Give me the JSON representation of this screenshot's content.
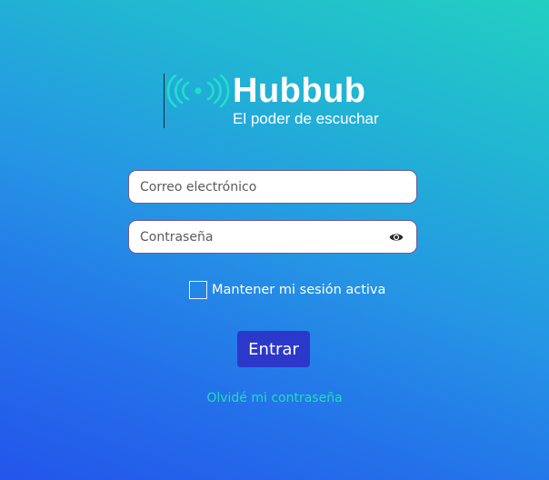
{
  "brand": {
    "name": "Hubbub",
    "tagline": "El poder de escuchar",
    "logo_icon": "broadcast-signal-icon",
    "accent_color": "#1ee0c8"
  },
  "login_form": {
    "email_placeholder": "Correo electrónico",
    "email_value": "",
    "password_placeholder": "Contraseña",
    "password_value": "",
    "password_toggle_icon": "eye-icon",
    "remember_label": "Mantener mi sesión activa",
    "remember_checked": false,
    "submit_label": "Entrar",
    "forgot_link": "Olvidé mi contraseña"
  },
  "colors": {
    "button_bg": "#2c38c9",
    "link": "#1ee0b4",
    "gradient_top_right": "#22cfc2",
    "gradient_bottom_left": "#2355ea"
  }
}
